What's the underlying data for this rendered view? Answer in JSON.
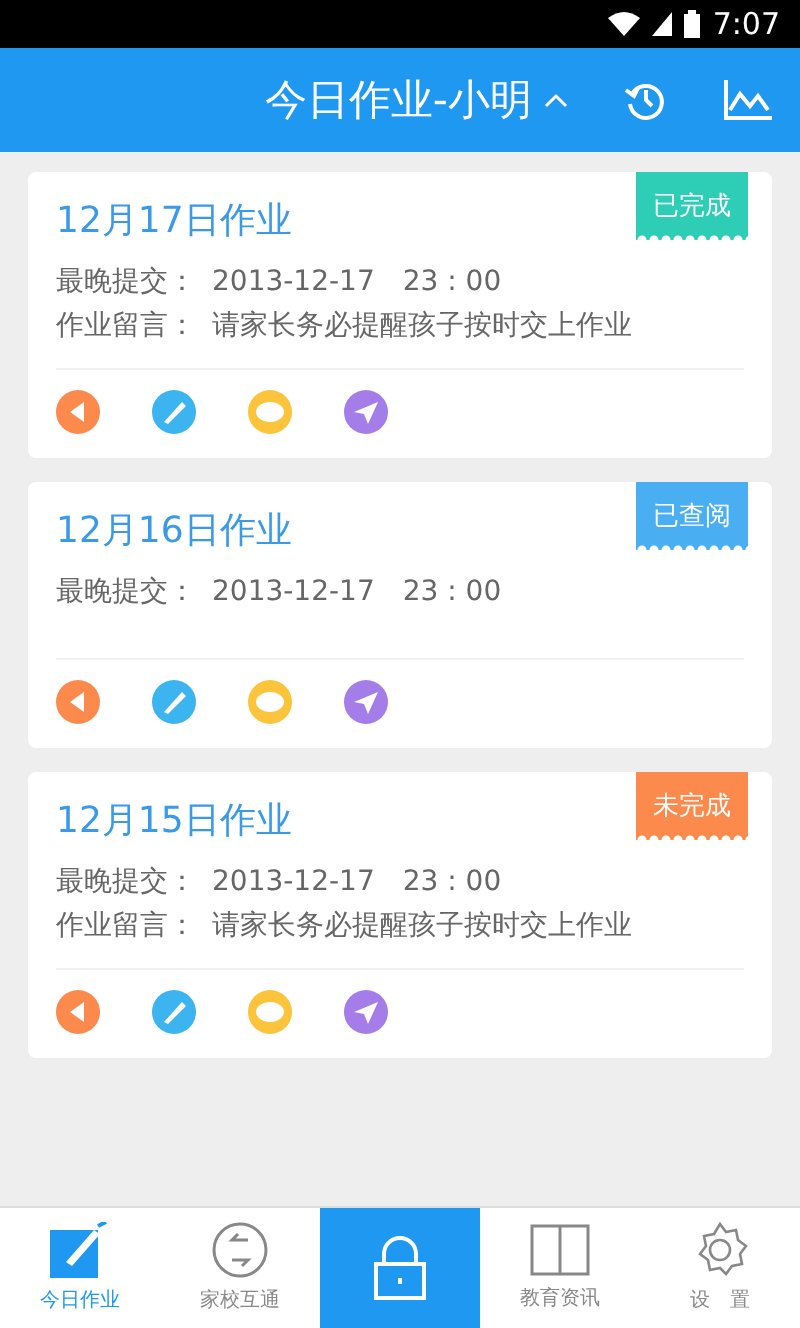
{
  "status_bar": {
    "time": "7:07"
  },
  "header": {
    "title": "今日作业-小明",
    "expanded": false
  },
  "cards": [
    {
      "title": "12月17日作业",
      "badge": {
        "label": "已完成",
        "color": "#2ecdb5"
      },
      "deadline_label": "最晚提交：",
      "deadline": "2013-12-17　23 : 00",
      "note_label": "作业留言：",
      "note": "请家长务必提醒孩子按时交上作业"
    },
    {
      "title": "12月16日作业",
      "badge": {
        "label": "已查阅",
        "color": "#4aaef2"
      },
      "deadline_label": "最晚提交：",
      "deadline": "2013-12-17　23 : 00"
    },
    {
      "title": "12月15日作业",
      "badge": {
        "label": "未完成",
        "color": "#fb8a4c"
      },
      "deadline_label": "最晚提交：",
      "deadline": "2013-12-17　23 : 00",
      "note_label": "作业留言：",
      "note": "请家长务必提醒孩子按时交上作业"
    }
  ],
  "tabs": [
    {
      "label": "今日作业",
      "kind": "edit",
      "selected": true
    },
    {
      "label": "家校互通",
      "kind": "exchange",
      "selected": false
    },
    {
      "kind": "lock",
      "selected": false
    },
    {
      "label": "教育资讯",
      "kind": "book",
      "selected": false
    },
    {
      "label": "设　置",
      "kind": "gear",
      "selected": false
    }
  ]
}
